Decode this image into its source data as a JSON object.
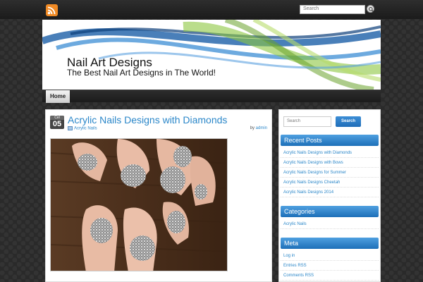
{
  "topbar": {
    "search_placeholder": "Search"
  },
  "header": {
    "site_title": "Nail Art Designs",
    "site_description": "The Best Nail Art Designs in The World!"
  },
  "nav": {
    "items": [
      {
        "label": "Home"
      }
    ]
  },
  "post": {
    "date_month": "Cel",
    "date_day": "05",
    "title": "Acrylic Nails Designs with Diamonds",
    "category": "Acrylic Nails",
    "by_label": "by",
    "author": "admin"
  },
  "sidebar": {
    "search_placeholder": "Search",
    "search_button": "Search",
    "recent_posts": {
      "title": "Recent Posts",
      "items": [
        "Acrylic Nails Designs with Diamonds",
        "Acrylic Nails Designs with Bows",
        "Acrylic Nails Designs for Summer",
        "Acrylic Nails Designs Cheetah",
        "Acrylic Nails Designs 2014"
      ]
    },
    "categories": {
      "title": "Categories",
      "items": [
        "Acrylic Nails"
      ]
    },
    "meta": {
      "title": "Meta",
      "items": [
        "Log in",
        "Entries RSS",
        "Comments RSS"
      ]
    }
  },
  "colors": {
    "link": "#2b87c9",
    "widget_header": "#1d6fb8",
    "rss": "#f08a24"
  },
  "icons": {
    "rss": "rss-icon",
    "search": "search-icon",
    "category": "category-icon"
  }
}
